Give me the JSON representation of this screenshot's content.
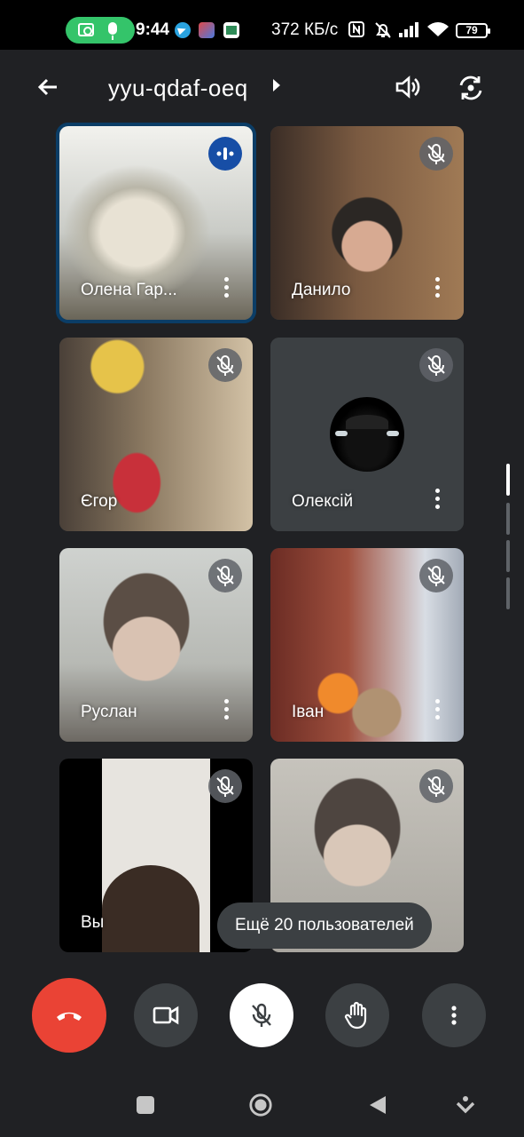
{
  "status_bar": {
    "time": "9:44",
    "network_speed": "372 КБ/с",
    "battery": "79"
  },
  "meeting": {
    "title": "yyu-qdaf-oeq"
  },
  "participants": [
    {
      "name": "Олена Гар...",
      "muted": false,
      "speaking": true
    },
    {
      "name": "Данило",
      "muted": true,
      "speaking": false
    },
    {
      "name": "Єгор",
      "muted": true,
      "speaking": false
    },
    {
      "name": "Олексій",
      "muted": true,
      "speaking": false
    },
    {
      "name": "Руслан",
      "muted": true,
      "speaking": false
    },
    {
      "name": "Іван",
      "muted": true,
      "speaking": false
    },
    {
      "name": "Вы",
      "muted": true,
      "speaking": false
    },
    {
      "name": "",
      "muted": true,
      "speaking": false
    }
  ],
  "more_users": "Ещё 20 пользователей",
  "colors": {
    "background": "#202124",
    "tile": "#3c4043",
    "end_call": "#ea4335",
    "speaking_badge": "#174ea6",
    "record_pill": "#34c46a"
  }
}
